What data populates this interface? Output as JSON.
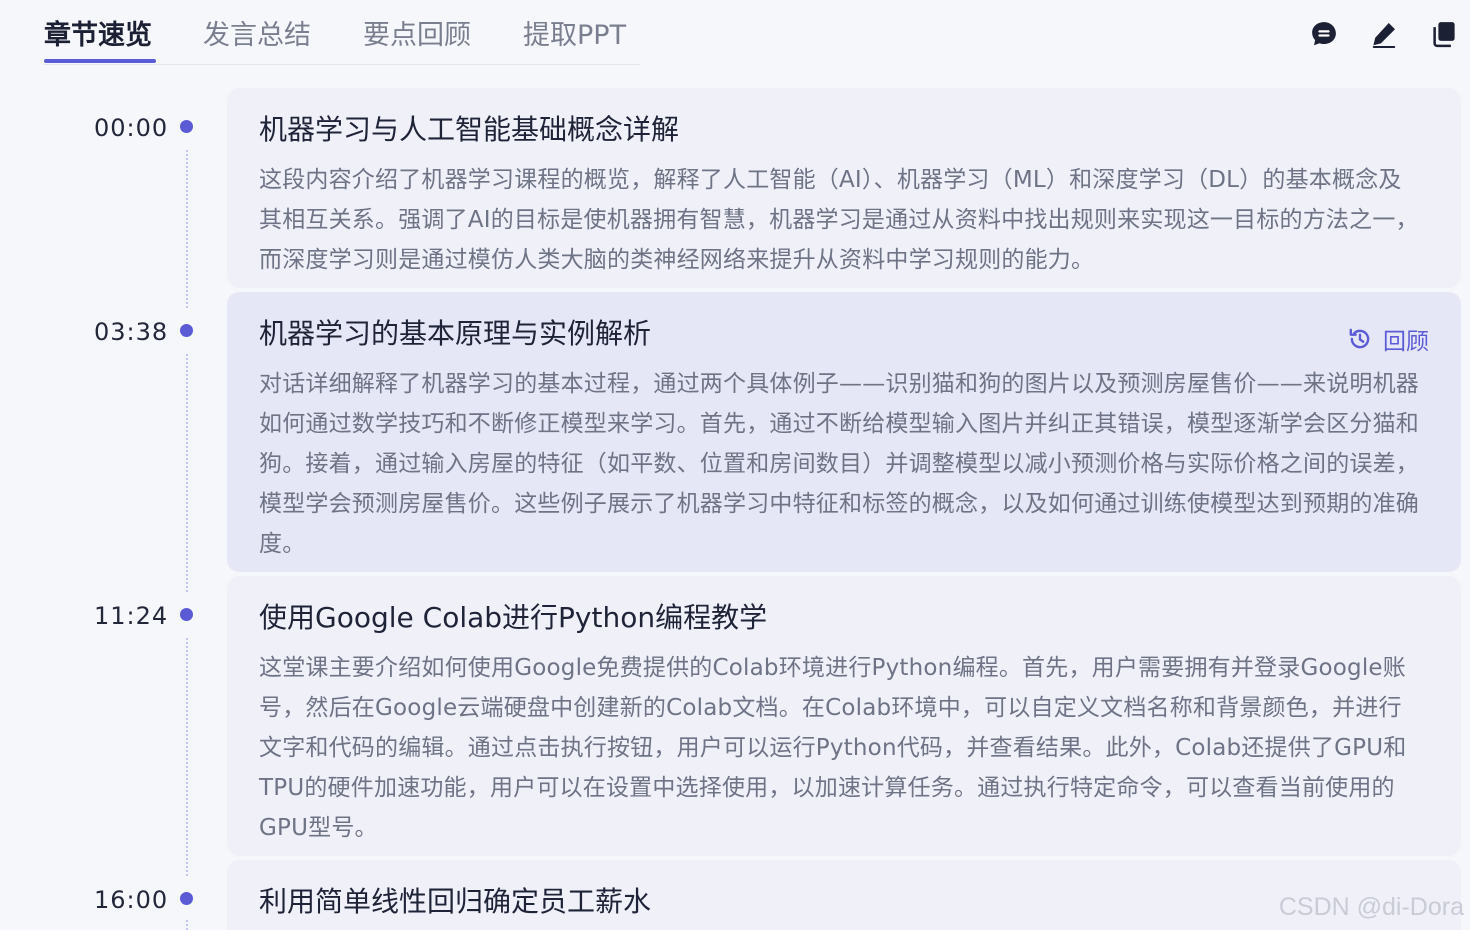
{
  "tabs": [
    {
      "label": "章节速览",
      "active": true
    },
    {
      "label": "发言总结",
      "active": false
    },
    {
      "label": "要点回顾",
      "active": false
    },
    {
      "label": "提取PPT",
      "active": false
    }
  ],
  "toolbar": {
    "icons": [
      "chat-icon",
      "edit-icon",
      "copy-icon"
    ]
  },
  "accent_color": "#5b5bd6",
  "chapters": [
    {
      "time": "00:00",
      "title": "机器学习与人工智能基础概念详解",
      "summary": "这段内容介绍了机器学习课程的概览，解释了人工智能（AI）、机器学习（ML）和深度学习（DL）的基本概念及其相互关系。强调了AI的目标是使机器拥有智慧，机器学习是通过从资料中找出规则来实现这一目标的方法之一，而深度学习则是通过模仿人类大脑的类神经网络来提升从资料中学习规则的能力。"
    },
    {
      "time": "03:38",
      "title": "机器学习的基本原理与实例解析",
      "summary": "对话详细解释了机器学习的基本过程，通过两个具体例子——识别猫和狗的图片以及预测房屋售价——来说明机器如何通过数学技巧和不断修正模型来学习。首先，通过不断给模型输入图片并纠正其错误，模型逐渐学会区分猫和狗。接着，通过输入房屋的特征（如平数、位置和房间数目）并调整模型以减小预测价格与实际价格之间的误差，模型学会预测房屋售价。这些例子展示了机器学习中特征和标签的概念，以及如何通过训练使模型达到预期的准确度。",
      "review_label": "回顾"
    },
    {
      "time": "11:24",
      "title": "使用Google Colab进行Python编程教学",
      "summary": "这堂课主要介绍如何使用Google免费提供的Colab环境进行Python编程。首先，用户需要拥有并登录Google账号，然后在Google云端硬盘中创建新的Colab文档。在Colab环境中，可以自定义文档名称和背景颜色，并进行文字和代码的编辑。通过点击执行按钮，用户可以运行Python代码，并查看结果。此外，Colab还提供了GPU和TPU的硬件加速功能，用户可以在设置中选择使用，以加速计算任务。通过执行特定命令，可以查看当前使用的GPU型号。"
    },
    {
      "time": "16:00",
      "title": "利用简单线性回归确定员工薪水",
      "summary": ""
    }
  ],
  "watermark": "CSDN @di-Dora"
}
